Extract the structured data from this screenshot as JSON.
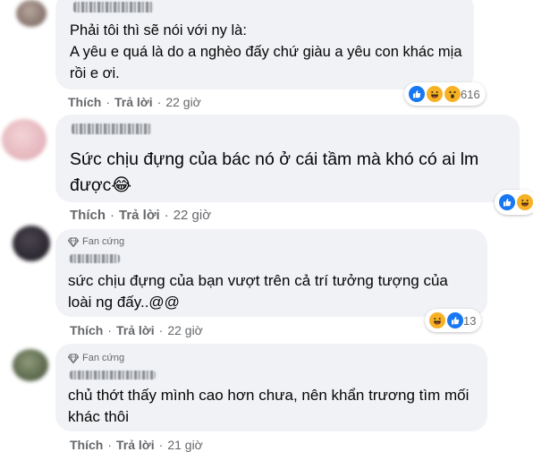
{
  "comments": [
    {
      "text": "Phải tôi thì sẽ nói với ny là:\nA yêu e quá là do a nghèo đấy chứ giàu a yêu con khác mịa rồi e ơi.",
      "actions": {
        "like": "Thích",
        "reply": "Trả lời"
      },
      "time": "22 giờ",
      "reactions": {
        "icons": [
          "like-icon",
          "haha-icon",
          "wow-icon"
        ],
        "count": "616"
      }
    },
    {
      "text": "Sức chịu đựng của bác nó ở cái tầm mà khó có ai lm được😂",
      "actions": {
        "like": "Thích",
        "reply": "Trả lời"
      },
      "time": "22 giờ",
      "reactions": {
        "icons": [
          "like-icon",
          "haha-icon"
        ],
        "count": ""
      }
    },
    {
      "badge": "Fan cứng",
      "text": "sức chịu đựng của bạn vượt trên cả trí tưởng tượng của loài ng đấy..@@",
      "actions": {
        "like": "Thích",
        "reply": "Trả lời"
      },
      "time": "22 giờ",
      "reactions": {
        "icons": [
          "haha-icon",
          "like-icon"
        ],
        "count": "13"
      }
    },
    {
      "badge": "Fan cứng",
      "text": "chủ thớt thấy mình cao hơn chưa, nên khẩn trương tìm mối khác thôi",
      "actions": {
        "like": "Thích",
        "reply": "Trả lời"
      },
      "time": "21 giờ"
    }
  ],
  "colors": {
    "bubble": "#f0f2f5",
    "meta_text": "#65676b",
    "like_blue": "#1877f2",
    "haha_yellow": "#f7b125",
    "avatar_1": "#8c7a72",
    "avatar_2": "#e6b9bf",
    "avatar_3": "#2e2a33",
    "avatar_4": "#5e6b4f"
  }
}
